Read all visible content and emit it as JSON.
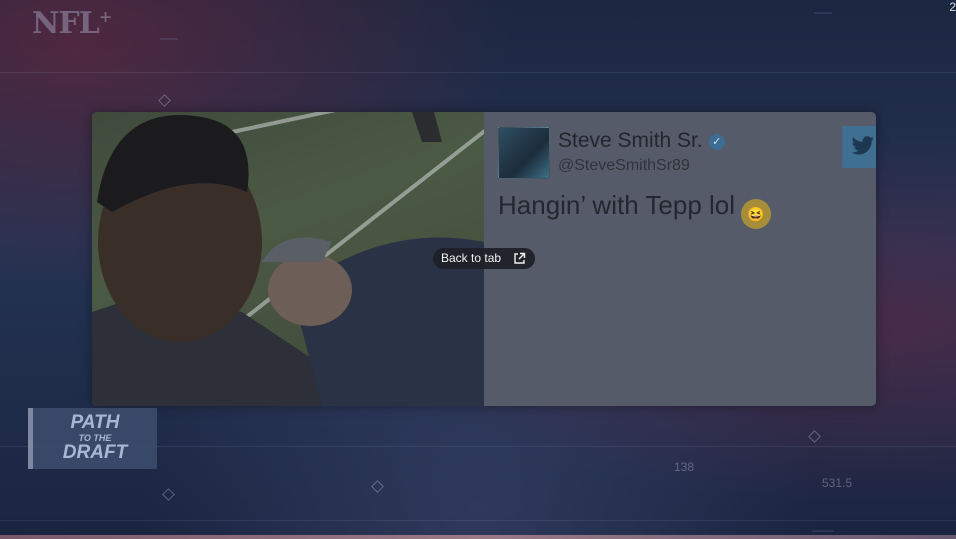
{
  "background": {
    "logo_text": "NFL",
    "logo_plus": "+",
    "numbers": [
      "138",
      "531.5"
    ],
    "corner_mark": "2"
  },
  "tweet": {
    "author_name": "Steve Smith Sr.",
    "author_handle": "@SteveSmithSr89",
    "text": "Hangin’ with Tepp lol",
    "emoji": "😆",
    "verified_icon": "verified-check-icon",
    "brand_icon": "twitter-bird-icon"
  },
  "overlay": {
    "back_to_tab_label": "Back to tab",
    "back_to_tab_icon": "external-link-icon"
  },
  "graphic": {
    "line1": "PATH",
    "line2": "TO THE",
    "line3": "DRAFT"
  },
  "colors": {
    "overlay_pill": "#1e2026",
    "twitter_badge": "#3f6f93",
    "page_bg": "#1d2a45"
  }
}
